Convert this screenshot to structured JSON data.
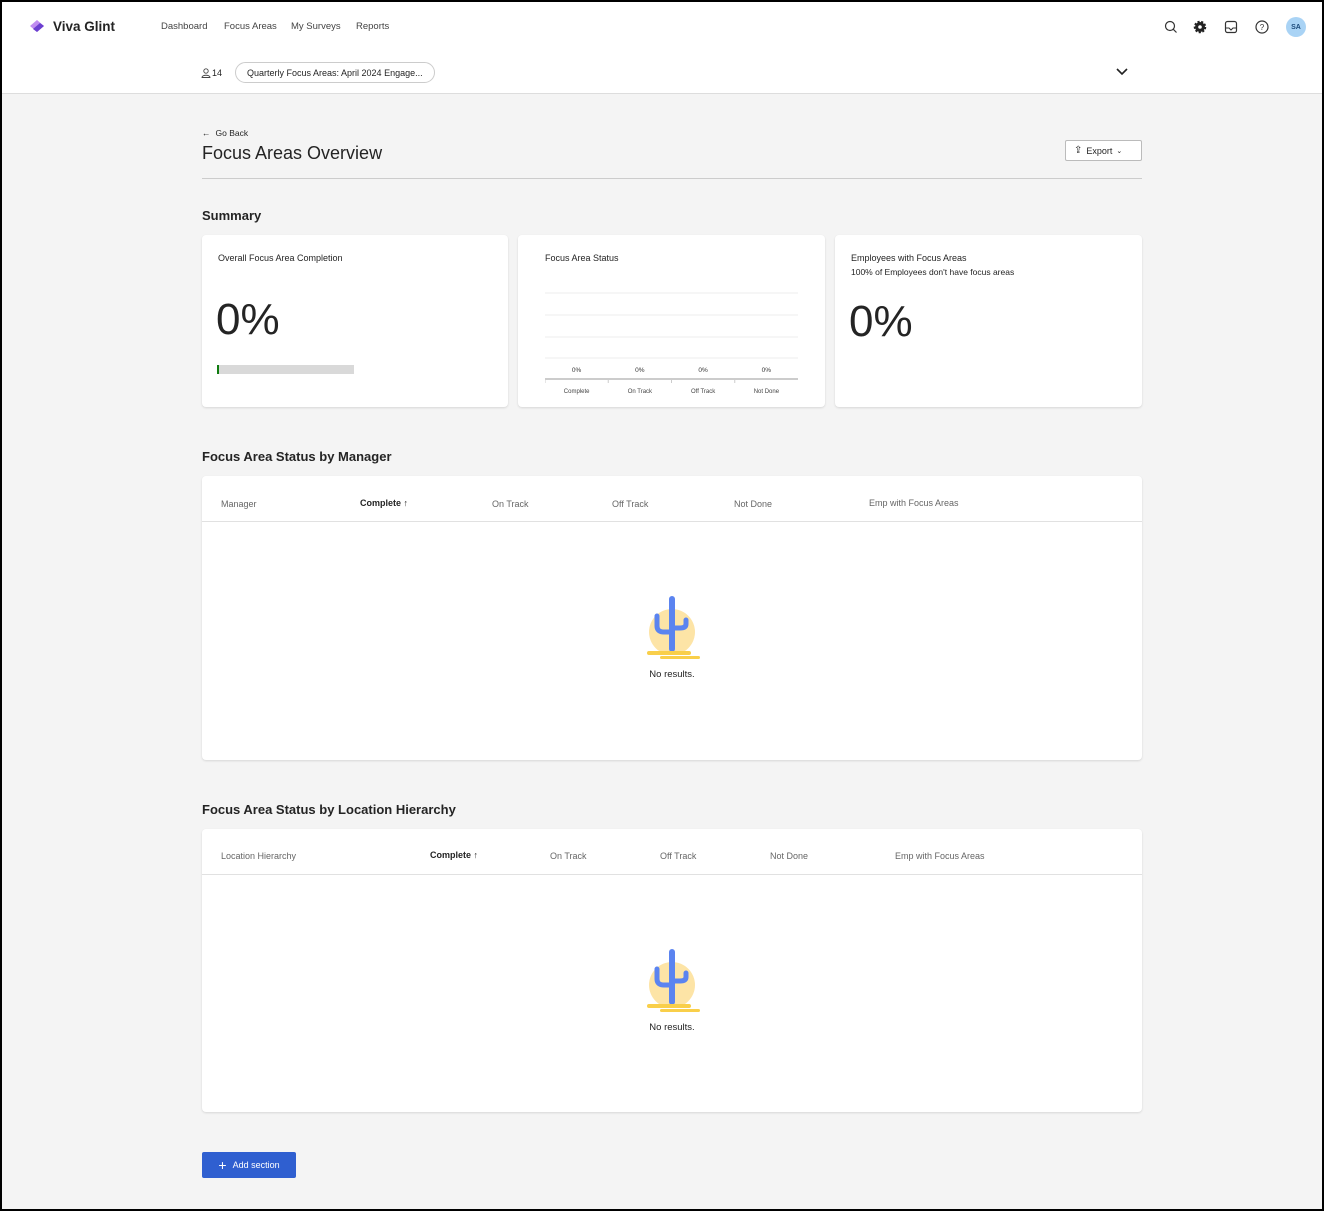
{
  "app": {
    "name": "Viva Glint",
    "brand_color": "#7b4fd6"
  },
  "nav": {
    "items": [
      "Dashboard",
      "Focus Areas",
      "My Surveys",
      "Reports"
    ]
  },
  "topbar_icons": [
    "search-icon",
    "gear-icon",
    "inbox-icon",
    "help-icon"
  ],
  "user": {
    "initials": "SA"
  },
  "subbar": {
    "participants": "14",
    "survey": "Quarterly Focus Areas: April 2024 Engage..."
  },
  "page": {
    "back": "Go Back",
    "title": "Focus Areas Overview",
    "export": "Export"
  },
  "summary": {
    "heading": "Summary",
    "completion": {
      "title": "Overall Focus Area Completion",
      "value": "0%",
      "progress": 0
    },
    "status": {
      "title": "Focus Area Status"
    },
    "employees": {
      "title": "Employees with Focus Areas",
      "subtitle": "100% of Employees don't have focus areas",
      "value": "0%"
    }
  },
  "chart_data": {
    "type": "bar",
    "categories": [
      "Complete",
      "On Track",
      "Off Track",
      "Not Done"
    ],
    "values": [
      0,
      0,
      0,
      0
    ],
    "data_labels": [
      "0%",
      "0%",
      "0%",
      "0%"
    ],
    "grid": true
  },
  "manager_table": {
    "heading": "Focus Area Status by Manager",
    "columns": [
      "Manager",
      "Complete",
      "On Track",
      "Off Track",
      "Not Done",
      "Emp with Focus Areas"
    ],
    "sorted_column": "Complete",
    "sort": "ascending",
    "empty": "No results."
  },
  "location_table": {
    "heading": "Focus Area Status by Location Hierarchy",
    "columns": [
      "Location Hierarchy",
      "Complete",
      "On Track",
      "Off Track",
      "Not Done",
      "Emp with Focus Areas"
    ],
    "sorted_column": "Complete",
    "sort": "ascending",
    "empty": "No results."
  },
  "add_section": "Add section",
  "colors": {
    "primary_button": "#2f5fd0",
    "progress_fill": "#107c10",
    "cactus": "#5b84f0",
    "sun": "#fde4a6"
  }
}
